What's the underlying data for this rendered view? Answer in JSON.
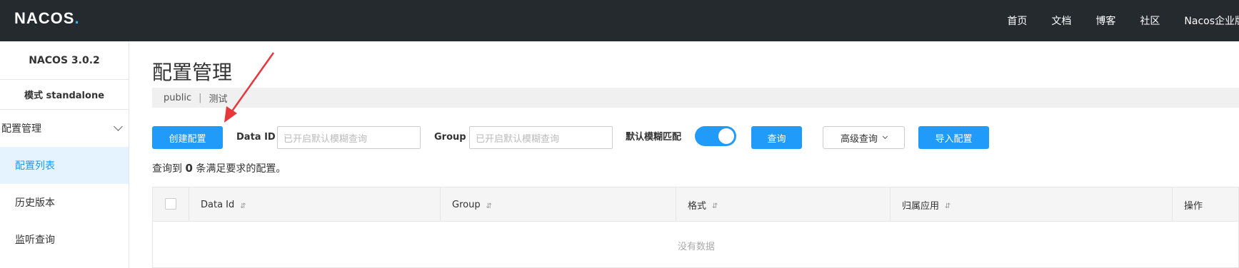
{
  "header": {
    "logo": "NACOS",
    "nav": [
      "首页",
      "文档",
      "博客",
      "社区",
      "Nacos企业版"
    ]
  },
  "sidebar": {
    "version": "NACOS 3.0.2",
    "mode": "模式 standalone",
    "group_label": "配置管理",
    "items": [
      {
        "label": "配置列表",
        "active": true
      },
      {
        "label": "历史版本",
        "active": false
      },
      {
        "label": "监听查询",
        "active": false
      }
    ]
  },
  "main": {
    "title": "配置管理",
    "namespace": "public",
    "namespace_separator": "|",
    "namespace_desc": "测试"
  },
  "toolbar": {
    "create_label": "创建配置",
    "data_id_label": "Data ID",
    "data_id_placeholder": "已开启默认模糊查询",
    "group_label": "Group",
    "group_placeholder": "已开启默认模糊查询",
    "fuzzy_label": "默认模糊匹配",
    "fuzzy_enabled": true,
    "search_label": "查询",
    "advanced_label": "高级查询",
    "import_label": "导入配置"
  },
  "result": {
    "prefix": "查询到",
    "count": "0",
    "suffix": "条满足要求的配置。"
  },
  "table": {
    "columns": [
      "Data Id",
      "Group",
      "格式",
      "归属应用",
      "操作"
    ],
    "sort_glyph": "⇵",
    "empty_text": "没有数据"
  },
  "colors": {
    "topbar": "#252a2f",
    "primary": "#209bfa",
    "active_bg": "#e4f3fe",
    "annotation_arrow": "#e8373a"
  }
}
